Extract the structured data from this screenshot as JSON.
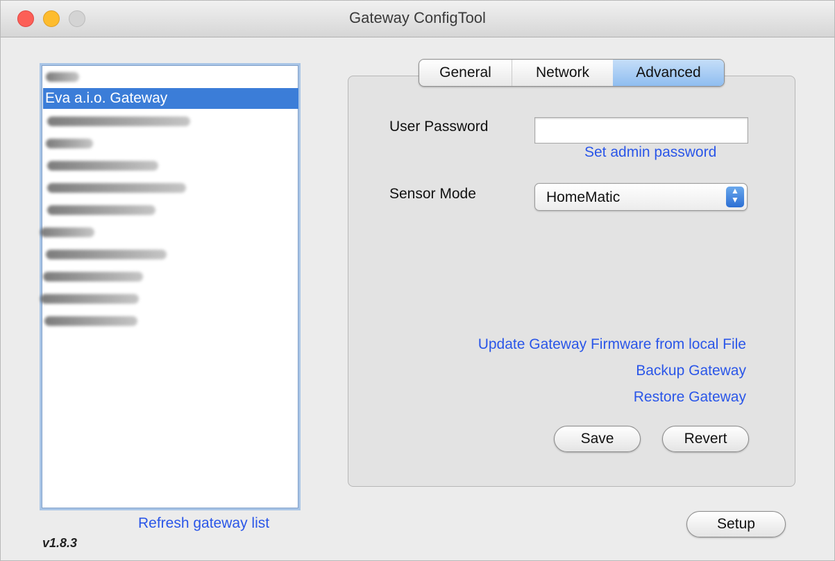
{
  "window": {
    "title": "Gateway ConfigTool"
  },
  "gateway_list": {
    "selected_label": "Eva a.i.o. Gateway",
    "refresh_label": "Refresh gateway list"
  },
  "version": "v1.8.3",
  "tabs": [
    {
      "label": "General"
    },
    {
      "label": "Network"
    },
    {
      "label": "Advanced",
      "active": true
    }
  ],
  "advanced": {
    "user_password_label": "User Password",
    "user_password_value": "",
    "set_admin_label": "Set admin password",
    "sensor_mode_label": "Sensor Mode",
    "sensor_mode_value": "HomeMatic",
    "update_fw_label": "Update Gateway Firmware from local File",
    "backup_label": "Backup Gateway",
    "restore_label": "Restore Gateway",
    "save_label": "Save",
    "revert_label": "Revert"
  },
  "setup_label": "Setup",
  "colors": {
    "selection": "#3b7dd8",
    "link": "#2a56e8",
    "active_tab": "#8fbdf0"
  }
}
